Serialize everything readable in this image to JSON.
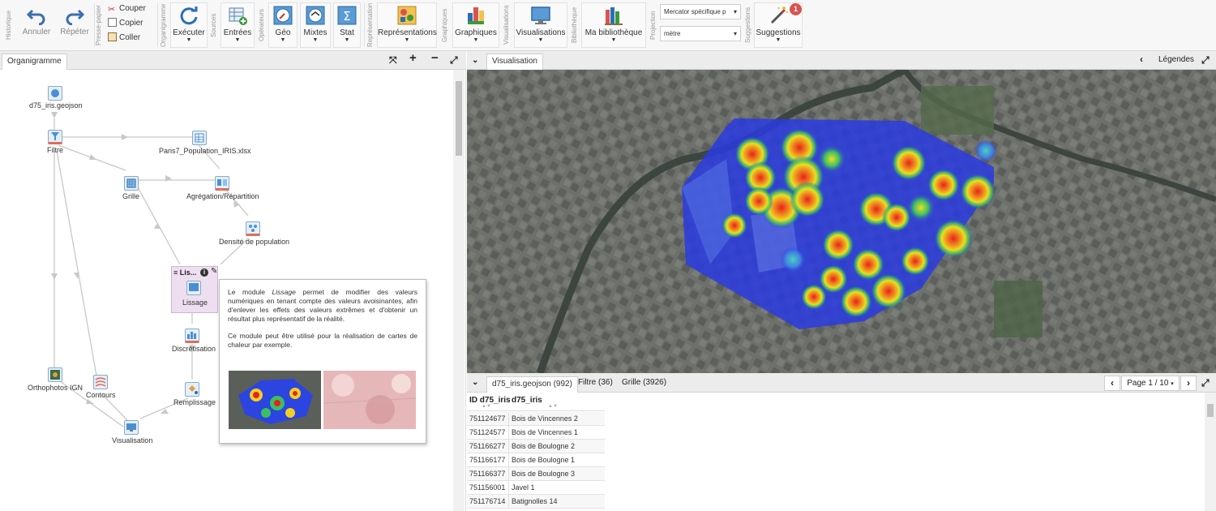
{
  "ribbon": {
    "groups": {
      "history": "Historique",
      "clipboard": "Presse-papier",
      "flowchart": "Organigramme",
      "sources": "Sources",
      "operators": "Opérateurs",
      "representations": "Représentations",
      "graphics": "Graphiques",
      "visualisations": "Visualisations",
      "library": "Bibliothèque",
      "projection": "Projection",
      "suggestions": "Suggestions"
    },
    "undo": "Annuler",
    "redo": "Répéter",
    "cut": "Couper",
    "copy": "Copier",
    "paste": "Coller",
    "run": "Exécuter",
    "inputs": "Entrées",
    "geo": "Géo",
    "mixed": "Mixtes",
    "stat": "Stat",
    "representations": "Représentations",
    "graphics": "Graphiques",
    "visualisations": "Visualisations",
    "library": "Ma bibliothèque",
    "projection_value": "Mercator spécifique p",
    "unit_value": "mètre",
    "suggestions": "Suggestions",
    "suggestions_count": "1"
  },
  "flowchart": {
    "tab": "Organigramme",
    "nodes": {
      "geojson": "d75_iris.geojson",
      "filter": "Filtre",
      "population": "Paris7_Population_IRIS.xlsx",
      "grid": "Grille",
      "aggregation": "Agrégation/Répartition",
      "density": "Densité de population",
      "smoothing_header": "Lis...",
      "smoothing": "Lissage",
      "discretisation": "Discrétisation",
      "orthophotos": "Orthophotos IGN",
      "contours": "Contours",
      "fill": "Remplissage",
      "visualisation": "Visualisation"
    },
    "tooltip": {
      "p1_before": "Le module ",
      "p1_em": "Lissage",
      "p1_after": " permet de modifier des valeurs numériques en tenant compte des valeurs avoisinantes, afin d'enlever les effets des valeurs extrêmes et d'obtenir un résultat plus représentatif de la réalité.",
      "p2": "Ce module peut être utilisé pour la réalisation de cartes de chaleur par exemple."
    }
  },
  "visualisation": {
    "tab": "Visualisation",
    "legends": "Légendes"
  },
  "data_table": {
    "tabs": [
      "d75_iris.geojson (992)",
      "Filtre (36)",
      "Grille (3926)"
    ],
    "page": "Page 1 / 10",
    "headers": [
      "ID d75_iris",
      "d75_iris"
    ],
    "rows": [
      [
        "751124677",
        "Bois de Vincennes 2"
      ],
      [
        "751124577",
        "Bois de Vincennes 1"
      ],
      [
        "751166277",
        "Bois de Boulogne 2"
      ],
      [
        "751166177",
        "Bois de Boulogne 1"
      ],
      [
        "751166377",
        "Bois de Boulogne 3"
      ],
      [
        "751156001",
        "Javel 1"
      ],
      [
        "751176714",
        "Batignolles 14"
      ]
    ]
  },
  "colors": {
    "accent": "#2a6ebb",
    "badge": "#d9534f",
    "heat_low": "#2a3be0",
    "heat_high": "#e8221a"
  }
}
